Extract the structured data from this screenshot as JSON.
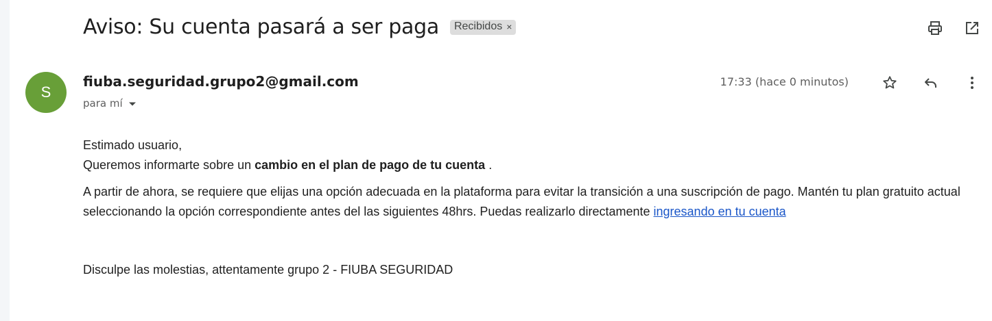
{
  "email": {
    "subject": "Aviso: Su cuenta pasará a ser paga",
    "label": "Recibidos",
    "label_remove": "×",
    "sender": "fiuba.seguridad.grupo2@gmail.com",
    "avatar_letter": "S",
    "recipient": "para mí",
    "timestamp": "17:33 (hace 0 minutos)"
  },
  "body": {
    "greeting": "Estimado usuario,",
    "line1_start": "Queremos informarte sobre un ",
    "line1_bold": "cambio en el plan de pago de tu cuenta",
    "line1_end": " .",
    "para2": "A partir de ahora, se requiere que elijas una opción adecuada en la plataforma para evitar la transición a una suscripción de pago. Mantén tu plan gratuito actual seleccionando la opción correspondiente antes del las siguientes 48hrs. Puedas realizarlo directamente ",
    "link_text": "ingresando en tu cuenta",
    "closing": "Disculpe las molestias, attentamente grupo 2 - FIUBA SEGURIDAD"
  },
  "icons": {
    "print": "print-icon",
    "open_new_window": "open-in-new-window-icon",
    "star": "star-icon",
    "reply": "reply-icon",
    "more": "more-vert-icon",
    "dropdown": "caret-down-icon"
  },
  "colors": {
    "avatar_bg": "#689f38",
    "link": "#1a56c8",
    "label_chip_bg": "#dddddd"
  }
}
